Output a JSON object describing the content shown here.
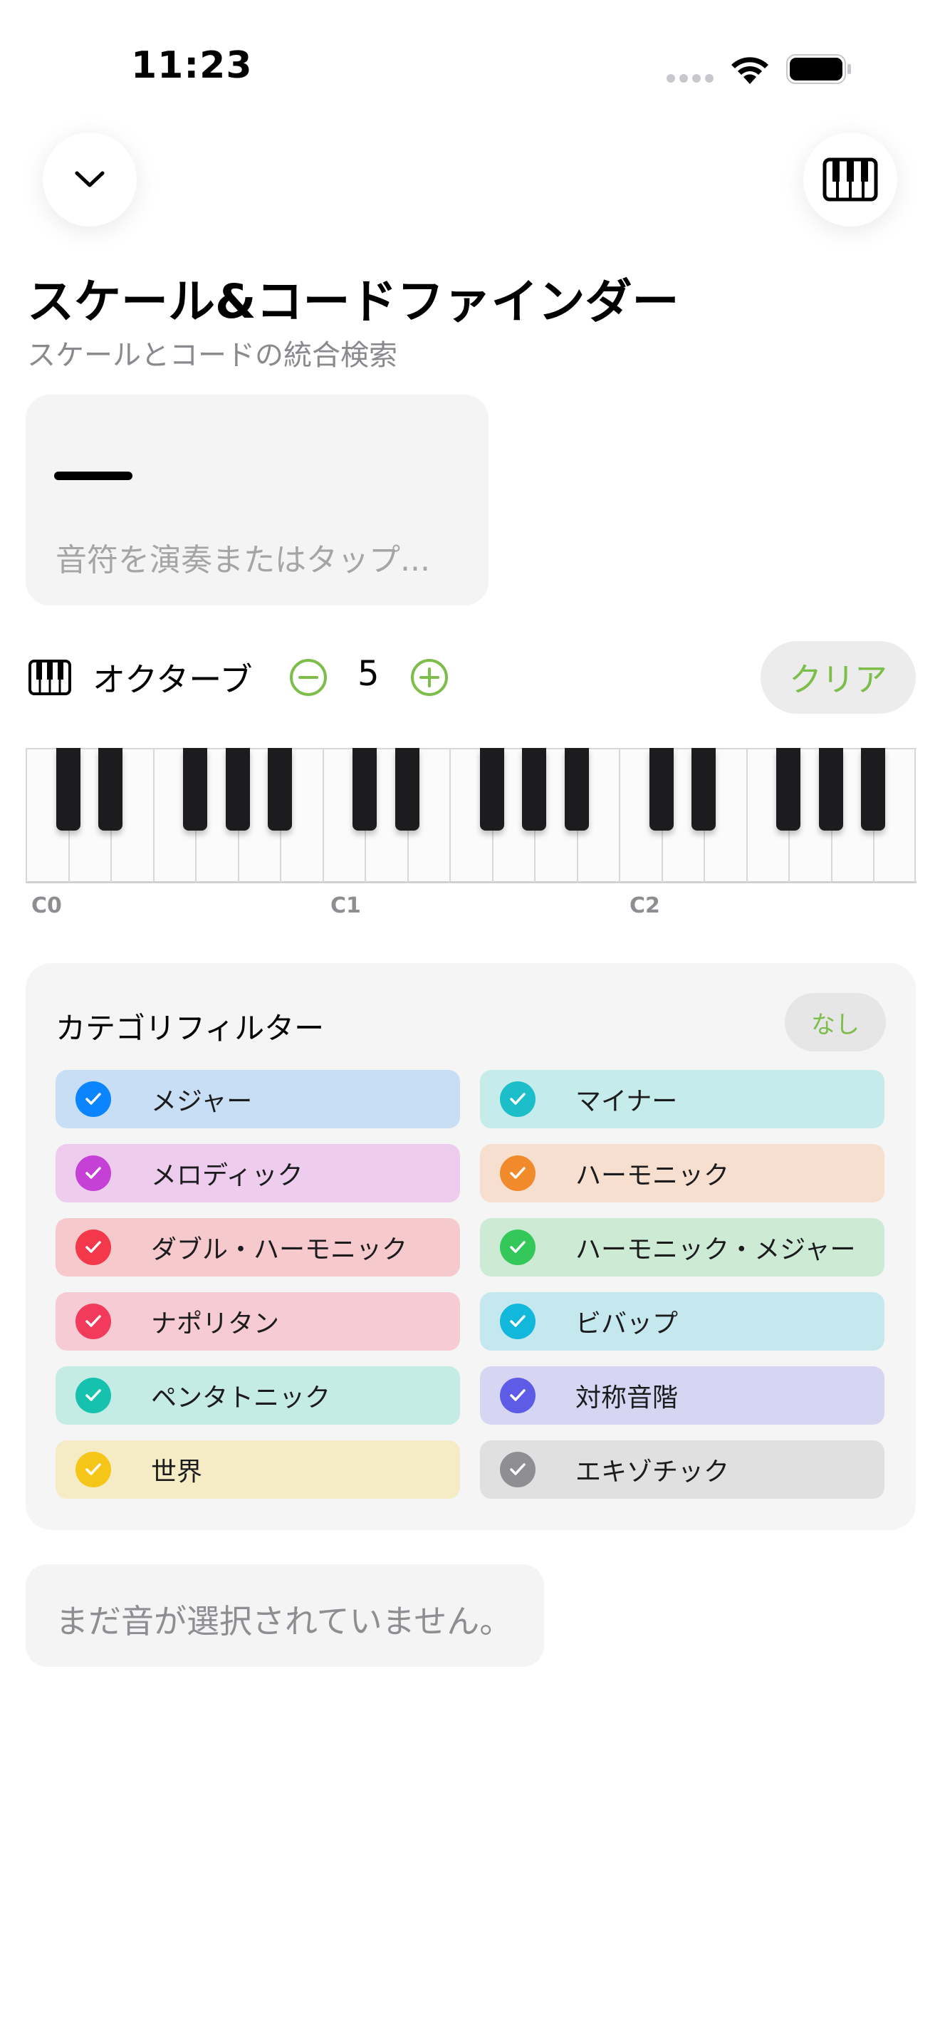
{
  "status_bar": {
    "time": "11:23"
  },
  "header": {
    "title": "スケール&コードファインダー",
    "subtitle": "スケールとコードの統合検索",
    "collapse_icon": "chevron-down-icon",
    "piano_icon": "piano-keys-icon"
  },
  "input": {
    "placeholder": "音符を演奏またはタップ..."
  },
  "octave": {
    "label": "オクターブ",
    "value": "5",
    "clear_label": "クリア"
  },
  "piano": {
    "octave_labels": [
      "C0",
      "C1",
      "C2"
    ]
  },
  "category_filter": {
    "title": "カテゴリフィルター",
    "none_label": "なし",
    "items": [
      {
        "label": "メジャー",
        "checked": true,
        "color": "#0a84ff",
        "bg": "#c8def5"
      },
      {
        "label": "マイナー",
        "checked": true,
        "color": "#1cbec9",
        "bg": "#c5ebeb"
      },
      {
        "label": "メロディック",
        "checked": true,
        "color": "#c541d6",
        "bg": "#edccee"
      },
      {
        "label": "ハーモニック",
        "checked": true,
        "color": "#f08a2b",
        "bg": "#f6dfce"
      },
      {
        "label": "ダブル・ハーモニック",
        "checked": true,
        "color": "#f2384a",
        "bg": "#f6cacd"
      },
      {
        "label": "ハーモニック・メジャー",
        "checked": true,
        "color": "#34c759",
        "bg": "#cdebd4"
      },
      {
        "label": "ナポリタン",
        "checked": true,
        "color": "#f23a5c",
        "bg": "#f6cbd3"
      },
      {
        "label": "ビバップ",
        "checked": true,
        "color": "#12b7dc",
        "bg": "#c5e8ef"
      },
      {
        "label": "ペンタトニック",
        "checked": true,
        "color": "#16c1ad",
        "bg": "#c5ebe5"
      },
      {
        "label": "対称音階",
        "checked": true,
        "color": "#5e5ce6",
        "bg": "#d6d6f2"
      },
      {
        "label": "世界",
        "checked": true,
        "color": "#f5c518",
        "bg": "#f5ecc5"
      },
      {
        "label": "エキゾチック",
        "checked": true,
        "color": "#8e8e93",
        "bg": "#e0e0e0"
      }
    ]
  },
  "result": {
    "empty_message": "まだ音が選択されていません。"
  },
  "colors": {
    "accent": "#7dbd4a"
  }
}
